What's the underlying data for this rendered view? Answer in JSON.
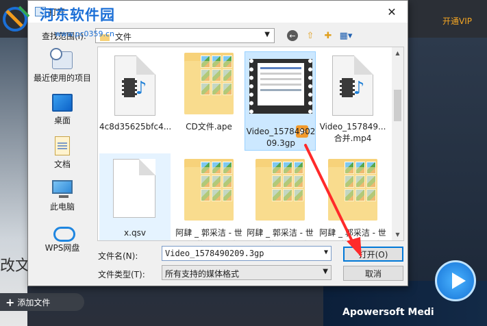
{
  "watermark": {
    "title": "河东软件园",
    "url": "www.pc0359.cn"
  },
  "background": {
    "vip_label": "开通VIP",
    "add_file_label": "添加文件",
    "brand_text": "Apowersoft Medi",
    "left_text": "改文"
  },
  "dialog": {
    "title": "打开",
    "close_glyph": "✕",
    "lookin_label": "查找范围(I):",
    "lookin_value": "文件",
    "places": [
      {
        "label": "最近使用的项目",
        "icon": "recent-icon"
      },
      {
        "label": "桌面",
        "icon": "desktop-icon"
      },
      {
        "label": "文档",
        "icon": "documents-icon"
      },
      {
        "label": "此电脑",
        "icon": "computer-icon"
      },
      {
        "label": "WPS网盘",
        "icon": "cloud-icon"
      }
    ],
    "files": [
      {
        "name": "4c8d35625bfc4...",
        "type": "media"
      },
      {
        "name": "CD文件.ape",
        "type": "folder"
      },
      {
        "name": "Video_15784902\n09.3gp",
        "type": "video",
        "selected": true
      },
      {
        "name": "Video_157849...\n合并.mp4",
        "type": "media"
      },
      {
        "name": "x.qsv",
        "type": "blank",
        "hover": true
      },
      {
        "name": "阿肆 _ 郭采洁 - 世\n界上的另一个我",
        "type": "folder"
      },
      {
        "name": "阿肆 _ 郭采洁 - 世\n界上的另一个我",
        "type": "folder"
      },
      {
        "name": "阿肆 _ 郭采洁 - 世\n界上的另一个我",
        "type": "folder"
      }
    ],
    "filename_label": "文件名(N):",
    "filename_value": "Video_1578490209.3gp",
    "filetype_label": "文件类型(T):",
    "filetype_value": "所有支持的媒体格式",
    "open_label": "打开(O)",
    "cancel_label": "取消"
  }
}
